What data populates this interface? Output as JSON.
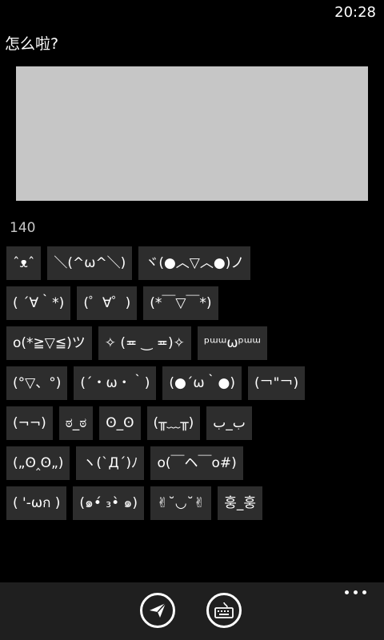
{
  "status_bar": {
    "time": "20:28"
  },
  "header": {
    "title": "怎么啦?"
  },
  "compose": {
    "value": "",
    "char_count": "140"
  },
  "emoticons": [
    [
      "ˆᴥˆ",
      "＼(^ω^＼)",
      "ヾ(●︿▽︿●)ノ"
    ],
    [
      "( ´∀｀*)",
      "(゜∀゜)",
      "(*￣▽￣*)"
    ],
    [
      "o(*≧▽≦)ツ",
      "✧ (≖ ‿ ≖)✧",
      "ᵖᵚᵚωᵖᵚᵚ"
    ],
    [
      "(°▽、°)",
      "(´・ω・｀)",
      "(●´ω｀●)",
      "(￢\"￢)"
    ],
    [
      "(¬¬)",
      "ಠ_ಠ",
      "ʘ_ʘ",
      "(╥﹏╥)",
      "ب_ب"
    ],
    [
      "(„ʘ‸ʘ„)",
      "ヽ(`Д´)ﾉ",
      "o(￣ヘ￣o#)"
    ],
    [
      "( '-ωก )",
      "(๑•́ ₃•̀ ๑)",
      "✌˘◡˘✌",
      "훙_훙"
    ]
  ],
  "app_bar": {
    "send_icon": "send-icon",
    "keyboard_icon": "keyboard-icon",
    "more_icon": "more-icon"
  }
}
